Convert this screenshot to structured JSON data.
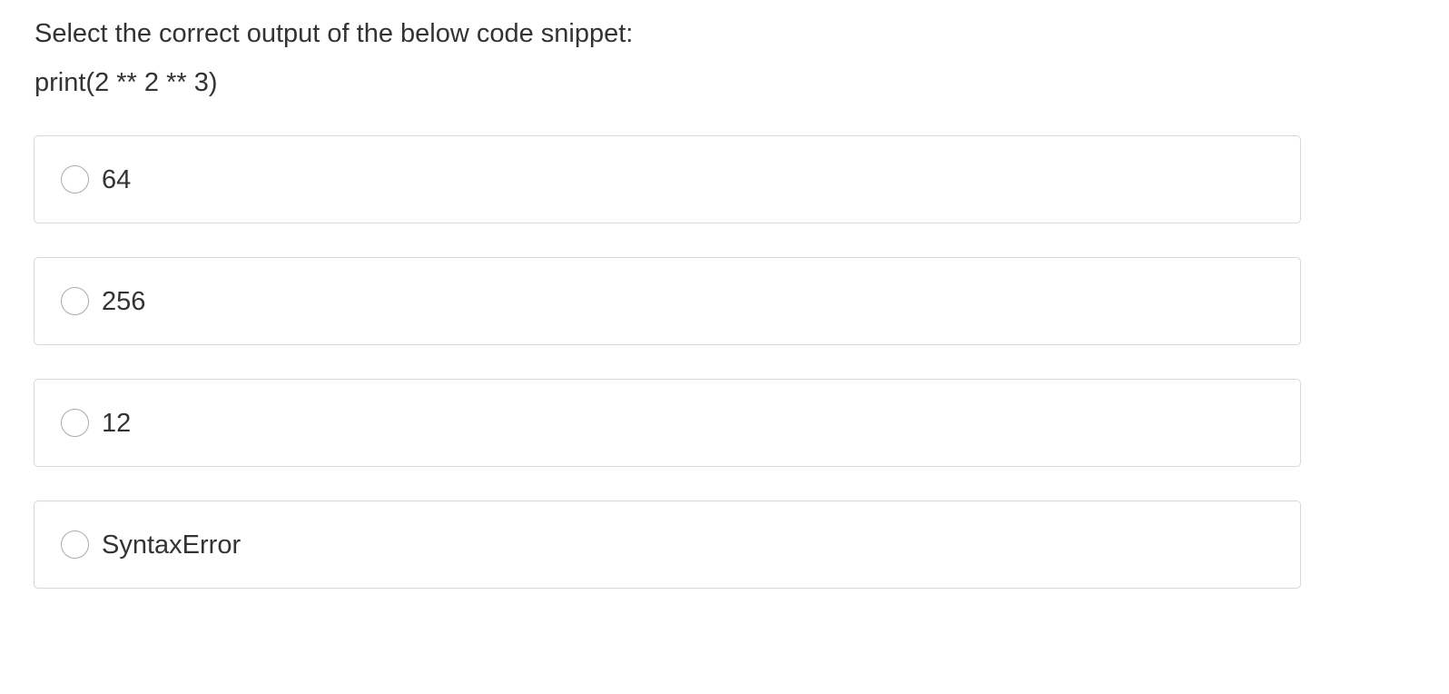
{
  "question": {
    "prompt": "Select the correct output of the below code snippet:",
    "code": "print(2 ** 2 ** 3)"
  },
  "options": [
    {
      "label": "64",
      "selected": false
    },
    {
      "label": "256",
      "selected": false
    },
    {
      "label": "12",
      "selected": false
    },
    {
      "label": "SyntaxError",
      "selected": false
    }
  ],
  "colors": {
    "text": "#333333",
    "border": "#d7d7dc",
    "radio_border": "#a9a9b3",
    "background": "#ffffff"
  }
}
